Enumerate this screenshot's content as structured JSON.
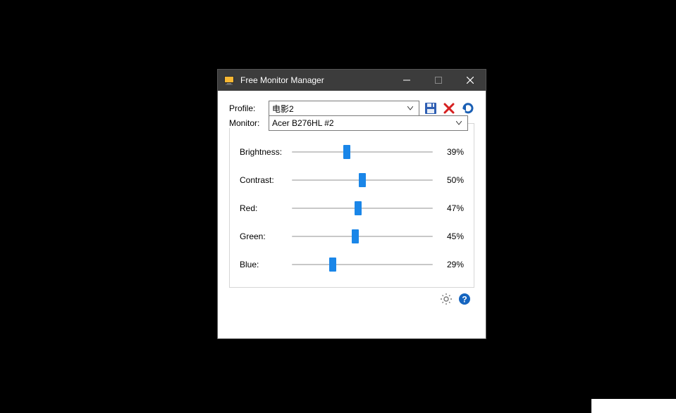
{
  "window": {
    "title": "Free Monitor Manager"
  },
  "profile": {
    "label": "Profile:",
    "selected": "电影2"
  },
  "monitor": {
    "label": "Monitor:",
    "selected": "Acer B276HL #2"
  },
  "sliders": [
    {
      "label": "Brightness:",
      "value": 39,
      "display": "39%"
    },
    {
      "label": "Contrast:",
      "value": 50,
      "display": "50%"
    },
    {
      "label": "Red:",
      "value": 47,
      "display": "47%"
    },
    {
      "label": "Green:",
      "value": 45,
      "display": "45%"
    },
    {
      "label": "Blue:",
      "value": 29,
      "display": "29%"
    }
  ],
  "colors": {
    "accent": "#1a86e8",
    "delete": "#d62020",
    "undo": "#1a5fb4",
    "help": "#1565c0"
  }
}
